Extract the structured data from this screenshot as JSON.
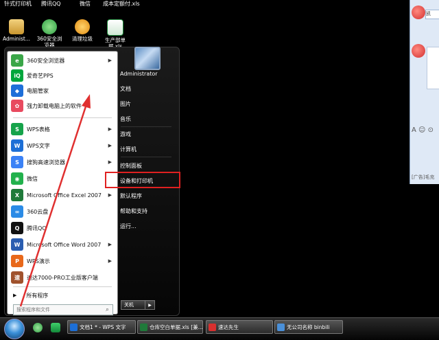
{
  "desktop": {
    "top_labels": [
      "针式打印机",
      "腾讯QQ",
      "微信",
      "成本定额付.xls"
    ],
    "icons": [
      {
        "label": "Administ...",
        "icon": "user-folder-icon",
        "color": "#d9b25a"
      },
      {
        "label": "360安全浏览器",
        "icon": "browser-360-icon",
        "color": "#3aa648"
      },
      {
        "label": "清理垃圾",
        "icon": "cleanup-icon",
        "color": "#f2a218"
      },
      {
        "label": "生产部单据.xls",
        "icon": "excel-file-icon",
        "color": "#1f8a3b"
      }
    ]
  },
  "chat": {
    "name_label": "凯",
    "ad_text": "[广告]毛充"
  },
  "start_menu": {
    "left_items": [
      {
        "label": "360安全浏览器",
        "icon": "browser-360-icon",
        "color": "#3aa648",
        "glyph": "e",
        "arrow": true
      },
      {
        "label": "爱奇艺PPS",
        "icon": "iqiyi-icon",
        "color": "#00a63c",
        "glyph": "iQ",
        "arrow": false
      },
      {
        "label": "电脑管家",
        "icon": "pc-manager-icon",
        "color": "#1e6fd9",
        "glyph": "◆",
        "arrow": false
      },
      {
        "label": "强力卸载电脑上的软件",
        "icon": "uninstall-icon",
        "color": "#e84a5f",
        "glyph": "✿",
        "arrow": false
      },
      {
        "label": "WPS表格",
        "icon": "wps-sheet-icon",
        "color": "#16a34a",
        "glyph": "S",
        "arrow": true
      },
      {
        "label": "WPS文字",
        "icon": "wps-writer-icon",
        "color": "#1d6fd6",
        "glyph": "W",
        "arrow": true
      },
      {
        "label": "搜狗高速浏览器",
        "icon": "sogou-browser-icon",
        "color": "#3b82f6",
        "glyph": "S",
        "arrow": true
      },
      {
        "label": "微信",
        "icon": "wechat-icon",
        "color": "#22b14c",
        "glyph": "◉",
        "arrow": false
      },
      {
        "label": "Microsoft Office Excel 2007",
        "icon": "excel-icon",
        "color": "#1f7a3a",
        "glyph": "X",
        "arrow": true
      },
      {
        "label": "360云盘",
        "icon": "cloud-360-icon",
        "color": "#2b8be6",
        "glyph": "∞",
        "arrow": false
      },
      {
        "label": "腾讯QQ",
        "icon": "qq-icon",
        "color": "#111111",
        "glyph": "Q",
        "arrow": false
      },
      {
        "label": "Microsoft Office Word 2007",
        "icon": "word-icon",
        "color": "#2a5db0",
        "glyph": "W",
        "arrow": true
      },
      {
        "label": "WPS演示",
        "icon": "wps-present-icon",
        "color": "#e8681a",
        "glyph": "P",
        "arrow": true
      },
      {
        "label": "速达7000-PRO工业版客户端",
        "icon": "suda-icon",
        "color": "#a0522d",
        "glyph": "速",
        "arrow": false
      }
    ],
    "all_programs": "所有程序",
    "search_placeholder": "搜索程序和文件",
    "right_items": [
      "Administrator",
      "文档",
      "图片",
      "音乐",
      "游戏",
      "计算机",
      "控制面板",
      "设备和打印机",
      "默认程序",
      "帮助和支持",
      "运行..."
    ],
    "shutdown_label": "关机"
  },
  "taskbar": {
    "buttons": [
      {
        "label": "文档1 * - WPS 文字",
        "icon": "wps-writer-icon",
        "color": "#1d6fd6"
      },
      {
        "label": "仓库空白单据.xls [兼...",
        "icon": "excel-file-icon",
        "color": "#1f7a3a"
      },
      {
        "label": "速达先生",
        "icon": "suda-icon",
        "color": "#d9302f"
      },
      {
        "label": "无公司名称 binbili",
        "icon": "app-window-icon",
        "color": "#4a90d9"
      }
    ]
  },
  "colors": {
    "highlight_box": "#e02020",
    "annotation_arrow": "#e03030"
  }
}
